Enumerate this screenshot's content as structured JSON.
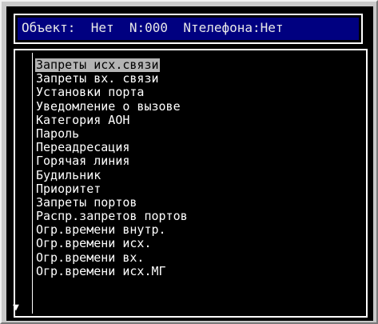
{
  "header": {
    "object_label": "Объект:",
    "object_value": "Нет",
    "n_value": "N:000",
    "phone_value": "Nтелефона:Нет"
  },
  "menu": {
    "items": [
      {
        "label": "Запреты исх.связи",
        "selected": true
      },
      {
        "label": "Запреты вх. связи"
      },
      {
        "label": "Установки порта"
      },
      {
        "label": "Уведомление о вызове"
      },
      {
        "label": "Категория АОН"
      },
      {
        "label": "Пароль"
      },
      {
        "label": "Переадресация"
      },
      {
        "label": "Горячая линия"
      },
      {
        "label": "Будильник"
      },
      {
        "label": "Приоритет"
      },
      {
        "label": "Запреты портов"
      },
      {
        "label": "Распр.запретов портов"
      },
      {
        "label": "Огр.времени внутр."
      },
      {
        "label": "Огр.времени исх."
      },
      {
        "label": "Огр.времени вх."
      },
      {
        "label": "Огр.времени исх.МГ"
      }
    ]
  },
  "scroll_indicator_icon": "down-triangle-icon",
  "colors": {
    "header_bg": "#000080",
    "selection_bg": "#b4b4b4",
    "screen_bg": "#000000",
    "text": "#ffffff"
  }
}
